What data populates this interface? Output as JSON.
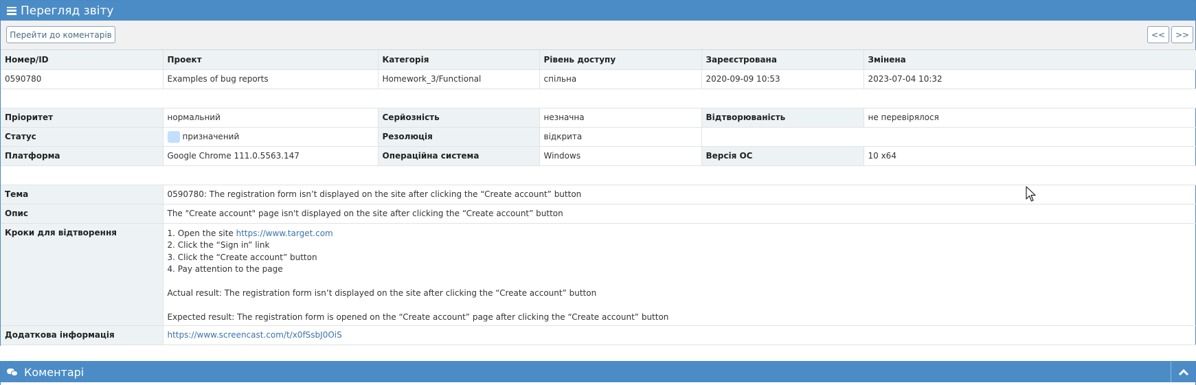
{
  "header": {
    "title": "Перегляд звіту",
    "icon": "hamburger-menu-icon"
  },
  "toolbar": {
    "comments_button": "Перейти до коментарів",
    "prev_button": "<<",
    "next_button": ">>"
  },
  "summary": {
    "headers": [
      "Номер/ID",
      "Проект",
      "Категорія",
      "Рівень доступу",
      "Зареєстрована",
      "Змінена"
    ],
    "values": [
      "0590780",
      "Examples of bug reports",
      "Homework_3/Functional",
      "спільна",
      "2020-09-09 10:53",
      "2023-07-04 10:32"
    ]
  },
  "details": {
    "priority_label": "Пріоритет",
    "priority": "нормальний",
    "severity_label": "Серйозність",
    "severity": "незначна",
    "reproducibility_label": "Відтворюваність",
    "reproducibility": "не перевірялося",
    "status_label": "Статус",
    "status": "призначений",
    "status_color": "#c2dfff",
    "resolution_label": "Резолюція",
    "resolution": "відкрита",
    "platform_label": "Платформа",
    "platform": "Google Chrome 111.0.5563.147",
    "os_label": "Операційна система",
    "os": "Windows",
    "os_version_label": "Версія ОС",
    "os_version": "10 x64"
  },
  "report": {
    "summary_label": "Тема",
    "summary": "0590780: The registration form isn’t displayed on the site after clicking the “Create account” button",
    "description_label": "Опис",
    "description": "The \"Create account\" page isn't displayed on the site after clicking the “Create account” button",
    "steps_label": "Кроки для відтворення",
    "step1_prefix": "1. Open the site ",
    "step1_link": "https://www.target.com",
    "step2": "2. Click the “Sign in” link",
    "step3": "3. Click the “Create account” button",
    "step4": "4. Pay attention to the page",
    "actual": "Actual result: The registration form isn’t displayed on the site after clicking the “Create account” button",
    "expected": "Expected result: The registration form is opened on the “Create account” page after clicking the “Create account” button",
    "additional_label": "Додаткова інформація",
    "additional_link": "https://www.screencast.com/t/x0fSsbJ0OiS"
  },
  "comments": {
    "title": "Коментарі",
    "icon": "comments-icon",
    "collapse_icon": "chevron-up-icon"
  },
  "colors": {
    "header_bg": "#4b8cc6",
    "category_bg": "#edf3f4",
    "link": "#3a73ad"
  }
}
